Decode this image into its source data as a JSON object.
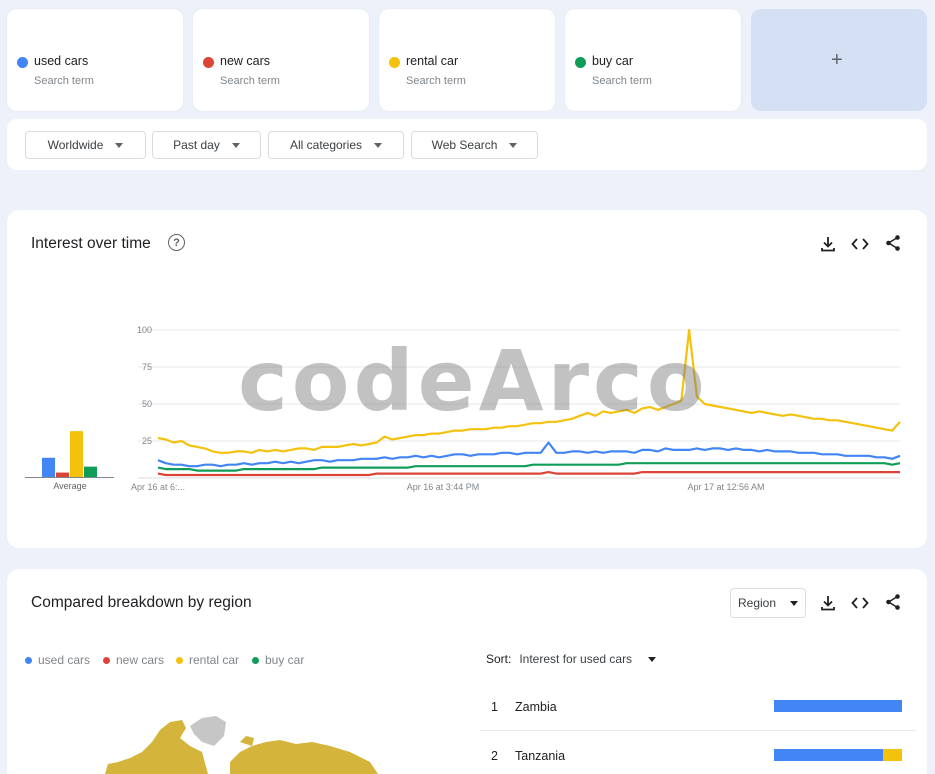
{
  "terms": [
    {
      "label": "used cars",
      "sub": "Search term",
      "color": "#4285f4"
    },
    {
      "label": "new cars",
      "sub": "Search term",
      "color": "#db4437"
    },
    {
      "label": "rental car",
      "sub": "Search term",
      "color": "#f4c20d"
    },
    {
      "label": "buy car",
      "sub": "Search term",
      "color": "#0f9d58"
    }
  ],
  "add_label": "+",
  "filters": {
    "region": "Worldwide",
    "time": "Past day",
    "category": "All categories",
    "search_type": "Web Search"
  },
  "interest": {
    "title": "Interest over time",
    "help": "?",
    "average_label": "Average",
    "x_ticks": [
      "Apr 16 at 6:...",
      "Apr 16 at 3:44 PM",
      "Apr 17 at 12:56 AM"
    ],
    "y_ticks": [
      "100",
      "75",
      "50",
      "25"
    ]
  },
  "watermark": "codeArco",
  "chart_data": {
    "type": "line",
    "ylim": [
      0,
      100
    ],
    "y_ticks": [
      25,
      50,
      75,
      100
    ],
    "x_tick_labels": [
      "Apr 16 at 6:...",
      "Apr 16 at 3:44 PM",
      "Apr 17 at 12:56 AM"
    ],
    "averages": [
      {
        "name": "used cars",
        "value": 13
      },
      {
        "name": "new cars",
        "value": 3
      },
      {
        "name": "rental car",
        "value": 31
      },
      {
        "name": "buy car",
        "value": 7
      }
    ],
    "series": [
      {
        "name": "used cars",
        "color": "#4285f4",
        "values": [
          12,
          10,
          9,
          9,
          8,
          8,
          9,
          9,
          8,
          9,
          9,
          10,
          9,
          10,
          10,
          11,
          10,
          11,
          10,
          11,
          12,
          12,
          11,
          12,
          12,
          12,
          13,
          13,
          13,
          14,
          13,
          14,
          14,
          15,
          14,
          15,
          14,
          15,
          16,
          16,
          15,
          16,
          16,
          16,
          17,
          17,
          16,
          17,
          17,
          17,
          24,
          17,
          17,
          18,
          18,
          17,
          18,
          17,
          18,
          18,
          18,
          17,
          19,
          19,
          18,
          20,
          19,
          19,
          19,
          20,
          19,
          20,
          20,
          19,
          20,
          19,
          19,
          18,
          19,
          18,
          18,
          18,
          17,
          17,
          17,
          16,
          16,
          16,
          15,
          15,
          15,
          15,
          14,
          14,
          13,
          15
        ]
      },
      {
        "name": "new cars",
        "color": "#db4437",
        "values": [
          3,
          2,
          2,
          2,
          2,
          2,
          2,
          2,
          2,
          2,
          2,
          2,
          2,
          2,
          2,
          2,
          2,
          2,
          2,
          2,
          2,
          2,
          2,
          2,
          2,
          2,
          2,
          2,
          3,
          3,
          3,
          3,
          3,
          3,
          3,
          3,
          3,
          3,
          3,
          3,
          3,
          3,
          3,
          3,
          3,
          3,
          3,
          3,
          3,
          3,
          4,
          3,
          3,
          3,
          3,
          3,
          3,
          3,
          3,
          3,
          3,
          3,
          4,
          4,
          4,
          4,
          4,
          4,
          4,
          4,
          4,
          4,
          4,
          4,
          4,
          4,
          4,
          4,
          4,
          4,
          4,
          4,
          4,
          4,
          4,
          4,
          4,
          4,
          4,
          4,
          4,
          4,
          4,
          4,
          4,
          4
        ]
      },
      {
        "name": "rental car",
        "color": "#f4c20d",
        "values": [
          27,
          26,
          24,
          25,
          22,
          21,
          20,
          18,
          17,
          17,
          18,
          18,
          17,
          19,
          18,
          19,
          18,
          19,
          20,
          20,
          19,
          21,
          21,
          21,
          22,
          23,
          22,
          23,
          24,
          28,
          26,
          27,
          28,
          29,
          29,
          30,
          30,
          31,
          32,
          32,
          33,
          33,
          33,
          34,
          34,
          35,
          35,
          36,
          37,
          37,
          38,
          38,
          39,
          40,
          42,
          44,
          42,
          45,
          44,
          45,
          46,
          44,
          47,
          48,
          46,
          48,
          50,
          52,
          100,
          55,
          50,
          49,
          48,
          47,
          46,
          45,
          44,
          45,
          44,
          43,
          42,
          43,
          42,
          41,
          40,
          40,
          39,
          39,
          38,
          37,
          36,
          35,
          34,
          33,
          32,
          38
        ]
      },
      {
        "name": "buy car",
        "color": "#0f9d58",
        "values": [
          7,
          6,
          6,
          6,
          6,
          5,
          5,
          5,
          5,
          5,
          5,
          6,
          6,
          6,
          6,
          6,
          6,
          6,
          6,
          6,
          6,
          7,
          7,
          7,
          7,
          7,
          7,
          7,
          7,
          7,
          7,
          7,
          7,
          8,
          8,
          8,
          8,
          8,
          8,
          8,
          8,
          8,
          8,
          8,
          8,
          8,
          8,
          8,
          9,
          9,
          9,
          9,
          9,
          9,
          9,
          9,
          9,
          9,
          9,
          9,
          10,
          10,
          10,
          10,
          10,
          10,
          10,
          10,
          10,
          10,
          10,
          10,
          10,
          10,
          10,
          10,
          10,
          10,
          10,
          10,
          10,
          10,
          10,
          10,
          10,
          10,
          10,
          10,
          10,
          10,
          10,
          10,
          10,
          10,
          9,
          10
        ]
      }
    ]
  },
  "breakdown": {
    "title": "Compared breakdown by region",
    "region_select": "Region",
    "legend": [
      "used cars",
      "new cars",
      "rental car",
      "buy car"
    ],
    "sort_label": "Sort:",
    "sort_value": "Interest for used cars",
    "rows": [
      {
        "rank": "1",
        "name": "Zambia",
        "shares": [
          1.0,
          0,
          0,
          0
        ]
      },
      {
        "rank": "2",
        "name": "Tanzania",
        "shares": [
          0.85,
          0,
          0.15,
          0
        ]
      }
    ]
  }
}
